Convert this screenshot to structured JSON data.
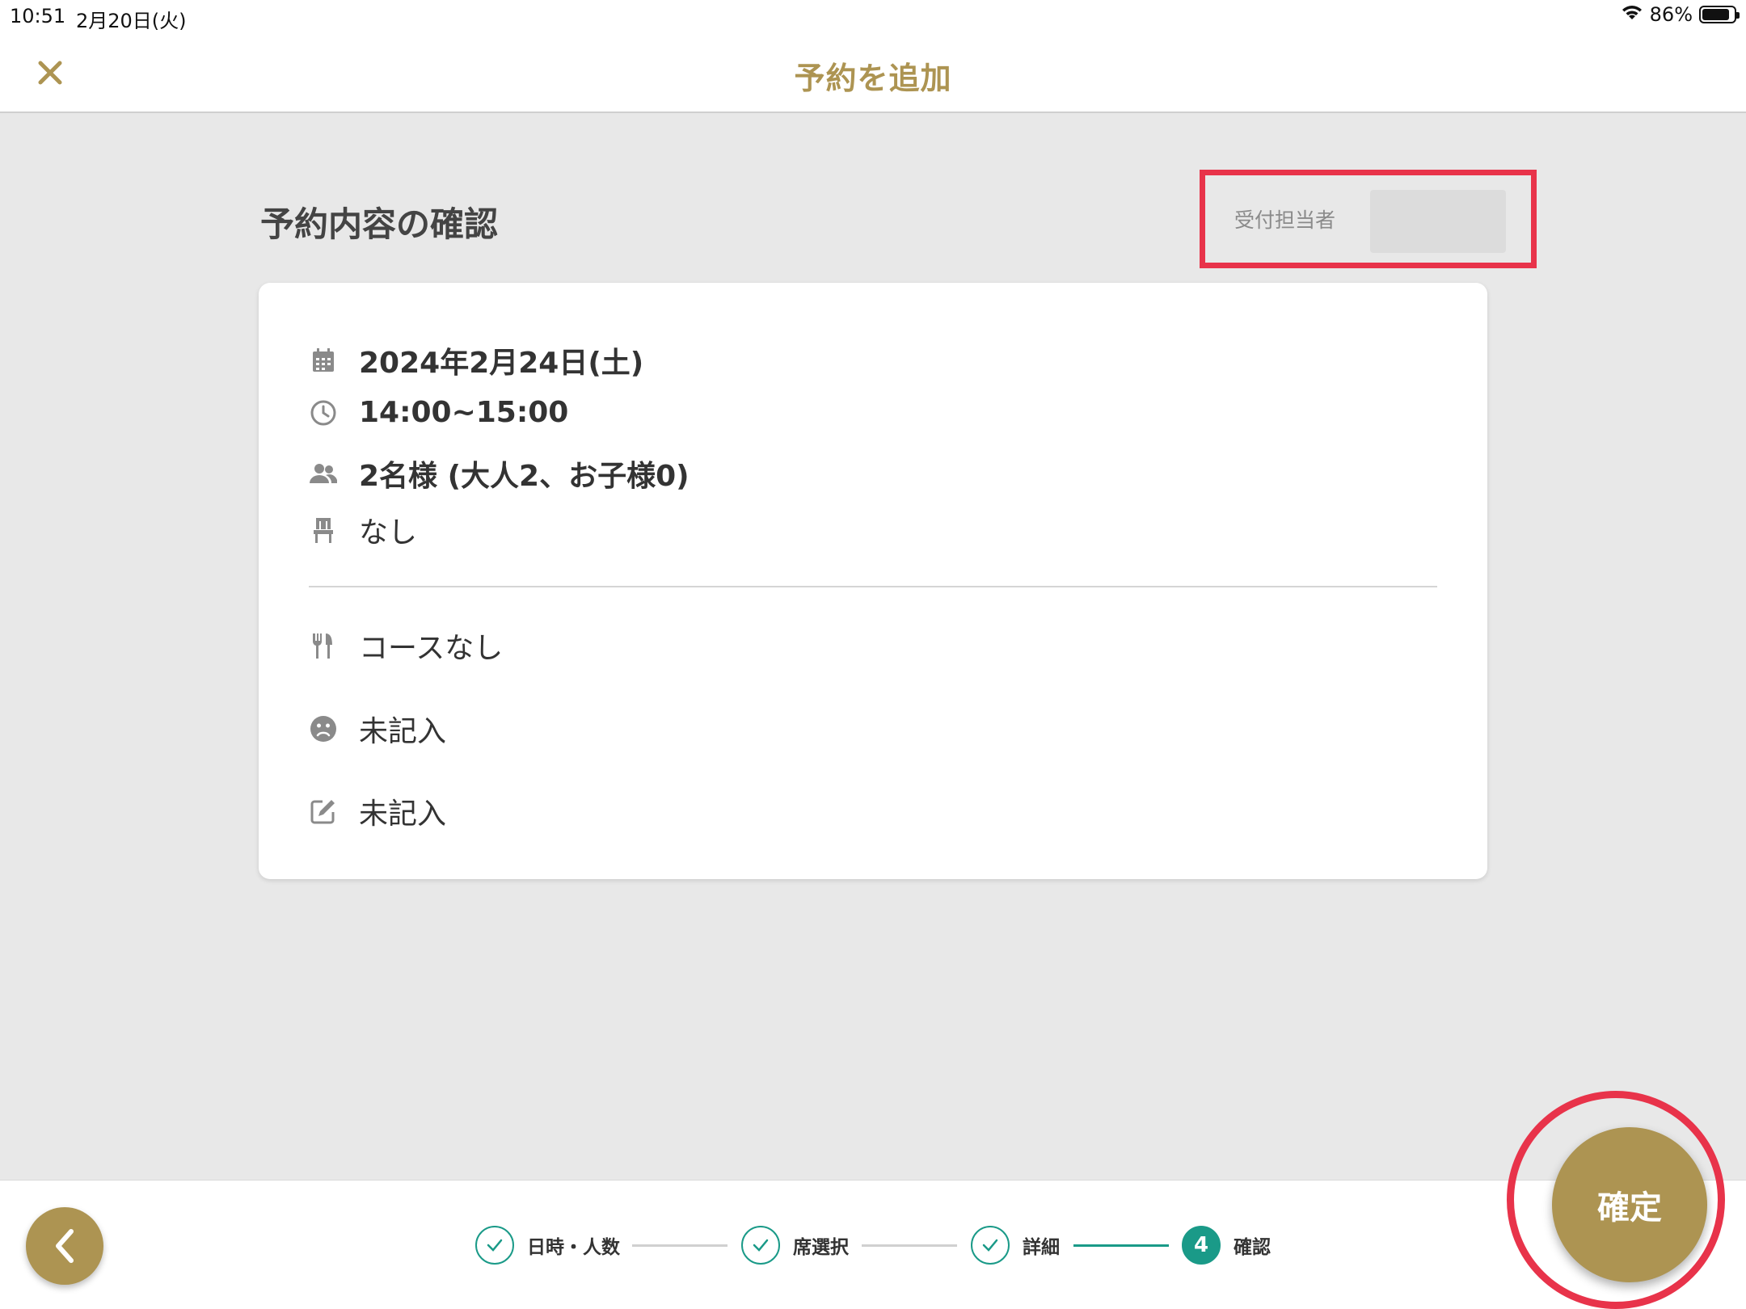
{
  "status_bar": {
    "time": "10:51",
    "date": "2月20日(火)",
    "battery": "86%",
    "battery_level": 0.86
  },
  "header": {
    "title": "予約を追加",
    "close_icon": "close-icon"
  },
  "main": {
    "section_title": "予約内容の確認",
    "receptionist_label": "受付担当者",
    "receptionist_value": ""
  },
  "card": {
    "date": "2024年2月24日(土)",
    "time": "14:00~15:00",
    "guests": "2名様 (大人2、お子様0)",
    "seat": "なし",
    "course": "コースなし",
    "allergy": "未記入",
    "memo": "未記入"
  },
  "stepper": {
    "steps": [
      {
        "label": "日時・人数",
        "state": "done"
      },
      {
        "label": "席選択",
        "state": "done"
      },
      {
        "label": "詳細",
        "state": "done"
      },
      {
        "label": "確認",
        "state": "active",
        "number": "4"
      }
    ]
  },
  "actions": {
    "confirm_label": "確定"
  },
  "colors": {
    "accent_gold": "#ad9452",
    "step_teal": "#1a9a88",
    "highlight_red": "#e8334a"
  }
}
